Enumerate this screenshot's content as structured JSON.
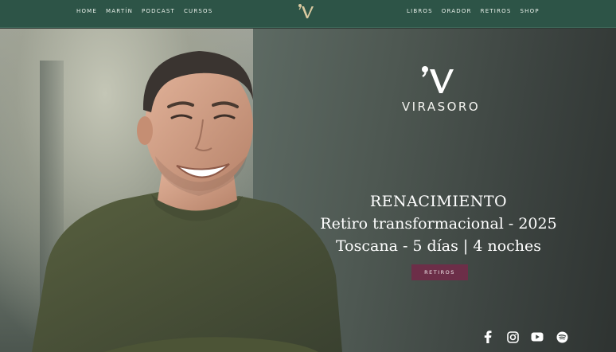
{
  "nav": {
    "left_items": [
      {
        "label": "Home"
      },
      {
        "label": "Martín"
      },
      {
        "label": "Podcast"
      },
      {
        "label": "Cursos"
      }
    ],
    "right_items": [
      {
        "label": "Libros"
      },
      {
        "label": "Orador"
      },
      {
        "label": "Retiros"
      },
      {
        "label": "Shop"
      }
    ],
    "logo_icon": "virasoro-v-monogram-icon"
  },
  "hero": {
    "brand": {
      "name": "VIRASORO",
      "mark_icon": "virasoro-v-monogram-icon"
    },
    "headline": {
      "line1": "RENACIMIENTO",
      "line2": "Retiro transformacional - 2025",
      "line3": "Toscana - 5 días | 4 noches"
    },
    "cta_label": "Retiros",
    "portrait_icon": "smiling-man-portrait-icon"
  },
  "social": [
    {
      "icon": "facebook-icon"
    },
    {
      "icon": "instagram-icon"
    },
    {
      "icon": "youtube-icon"
    },
    {
      "icon": "spotify-icon"
    }
  ],
  "colors": {
    "nav_bg": "#2d5447",
    "cta_bg": "#6c2e48",
    "text_light": "#ffffff"
  }
}
